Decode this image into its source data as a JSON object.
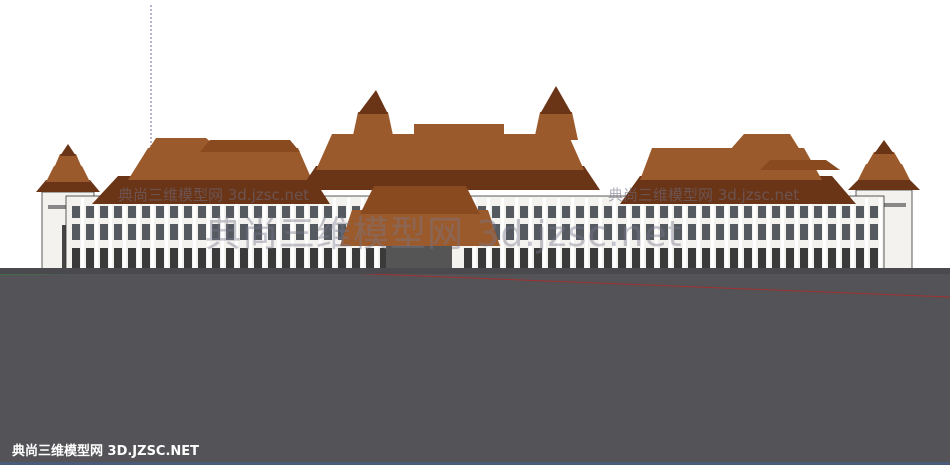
{
  "viewport": {
    "sky_color": "#ffffff",
    "ground_color": "#545458",
    "roof_color": "#9b5a2c",
    "roof_dark_color": "#6a3416",
    "wall_color": "#f4f2ee"
  },
  "watermarks": {
    "small_left": "典尚三维模型网 3d.jzsc.net",
    "small_right": "典尚三维模型网 3d.jzsc.net",
    "large": "典尚三维模型网 3d.jzsc.net",
    "footer": "典尚三维模型网 3D.JZSC.NET"
  }
}
